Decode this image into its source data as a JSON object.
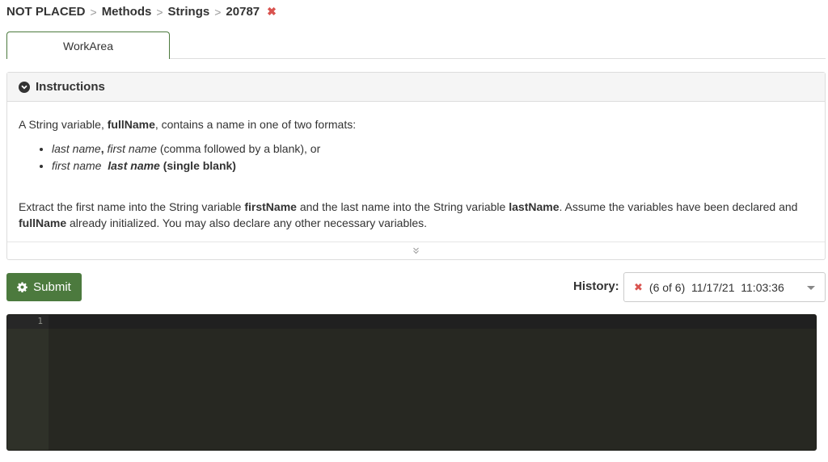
{
  "breadcrumb": {
    "items": [
      "NOT PLACED",
      "Methods",
      "Strings",
      "20787"
    ],
    "separator": ">",
    "close_glyph": "✖"
  },
  "tabs": [
    {
      "label": "WorkArea",
      "active": true
    }
  ],
  "instructions": {
    "title": "Instructions",
    "icon": "chevron-circle-down-icon",
    "intro": {
      "t1": "A String variable, ",
      "var": "fullName",
      "t2": ", contains a name in one of two formats:"
    },
    "formats": [
      {
        "a": "last name",
        "b": ",",
        "c": " first name",
        "d": " (comma followed by a blank), or"
      },
      {
        "a": "first name",
        "b": "last name",
        "c": " (single blank)"
      }
    ],
    "extract": {
      "t1": "Extract the first name into the String variable ",
      "v1": "firstName",
      "t2": " and the last name into the String variable ",
      "v2": "lastName",
      "t3": ". Assume the variables have been declared and ",
      "v3": "fullName",
      "t4": " already initialized. You may also declare any other necessary variables."
    },
    "expand_icon": "double-chevron-down-icon"
  },
  "submit": {
    "label": "Submit",
    "icon": "gear-icon",
    "color": "#4c7a3e"
  },
  "history": {
    "label": "History:",
    "status_glyph": "✖",
    "selected": "(6 of 6)  11/17/21  11:03:36"
  },
  "editor": {
    "line_numbers": [
      "1"
    ],
    "code": "",
    "theme_bg": "#272822"
  }
}
